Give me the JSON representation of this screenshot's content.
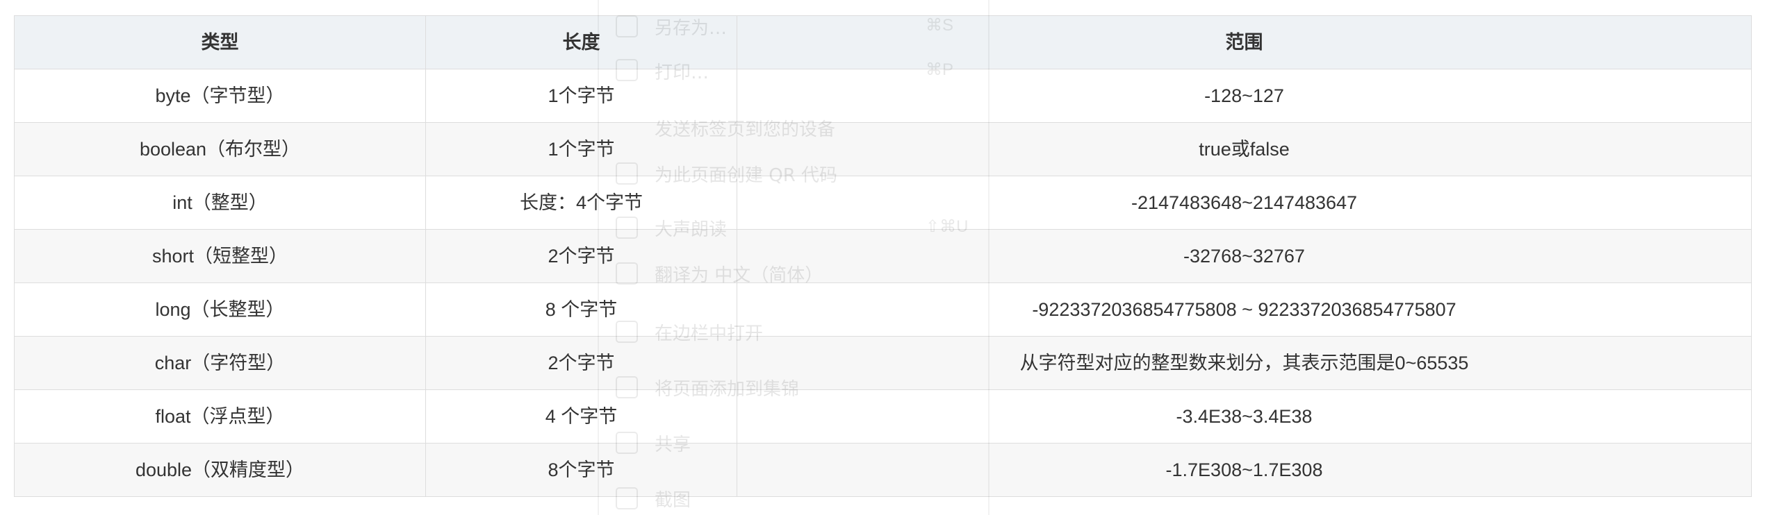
{
  "table": {
    "headers": [
      "类型",
      "长度",
      "范围"
    ],
    "rows": [
      [
        "byte（字节型）",
        "1个字节",
        "-128~127"
      ],
      [
        "boolean（布尔型）",
        "1个字节",
        "true或false"
      ],
      [
        "int（整型）",
        "长度：4个字节",
        "-2147483648~2147483647"
      ],
      [
        "short（短整型）",
        "2个字节",
        "-32768~32767"
      ],
      [
        "long（长整型）",
        "8 个字节",
        "-9223372036854775808 ~ 9223372036854775807"
      ],
      [
        "char（字符型）",
        "2个字节",
        "从字符型对应的整型数来划分，其表示范围是0~65535"
      ],
      [
        "float（浮点型）",
        "4 个字节",
        "-3.4E38~3.4E38"
      ],
      [
        "double（双精度型）",
        "8个字节",
        "-1.7E308~1.7E308"
      ]
    ]
  },
  "ghost_menu": {
    "items": [
      "另存为…",
      "打印…",
      "发送标签页到您的设备",
      "为此页面创建 QR 代码",
      "大声朗读",
      "翻译为 中文（简体）",
      "在边栏中打开",
      "将页面添加到集锦",
      "共享",
      "截图"
    ],
    "shortcuts": [
      "⌘S",
      "⌘P",
      "",
      "",
      "⇧⌘U",
      "",
      "",
      "",
      "",
      ""
    ]
  }
}
